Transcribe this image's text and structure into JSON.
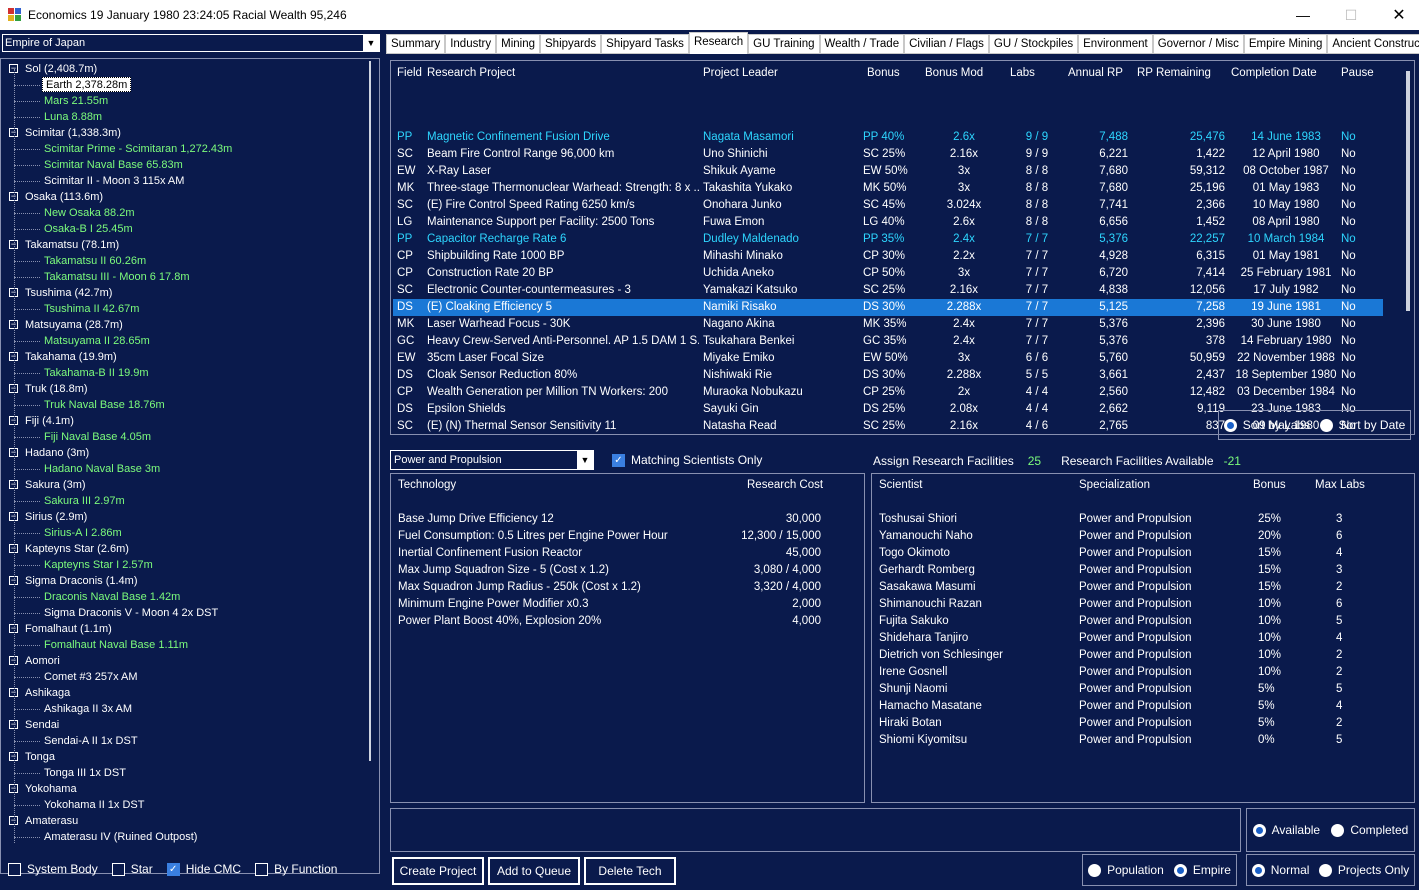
{
  "window": {
    "title": "Economics   19 January 1980 23:24:05   Racial Wealth 95,246",
    "minimize": "—",
    "maximize": "☐",
    "close": "✕"
  },
  "empire_select": {
    "value": "Empire of Japan"
  },
  "tree": [
    {
      "label": "Sol  (2,408.7m)",
      "level": 0,
      "color": "white"
    },
    {
      "label": "Earth  2,378.28m",
      "level": 1,
      "color": "selected"
    },
    {
      "label": "Mars  21.55m",
      "level": 1,
      "color": "green"
    },
    {
      "label": "Luna  8.88m",
      "level": 1,
      "color": "green"
    },
    {
      "label": "Scimitar  (1,338.3m)",
      "level": 0,
      "color": "white"
    },
    {
      "label": "Scimitar Prime - Scimitaran  1,272.43m",
      "level": 1,
      "color": "green"
    },
    {
      "label": "Scimitar Naval Base  65.83m",
      "level": 1,
      "color": "green"
    },
    {
      "label": "Scimitar II - Moon 3  115x AM",
      "level": 1,
      "color": "white"
    },
    {
      "label": "Osaka  (113.6m)",
      "level": 0,
      "color": "white"
    },
    {
      "label": "New Osaka  88.2m",
      "level": 1,
      "color": "green"
    },
    {
      "label": "Osaka-B I  25.45m",
      "level": 1,
      "color": "green"
    },
    {
      "label": "Takamatsu  (78.1m)",
      "level": 0,
      "color": "white"
    },
    {
      "label": "Takamatsu II  60.26m",
      "level": 1,
      "color": "green"
    },
    {
      "label": "Takamatsu III - Moon 6  17.8m",
      "level": 1,
      "color": "green"
    },
    {
      "label": "Tsushima  (42.7m)",
      "level": 0,
      "color": "white"
    },
    {
      "label": "Tsushima II  42.67m",
      "level": 1,
      "color": "green"
    },
    {
      "label": "Matsuyama  (28.7m)",
      "level": 0,
      "color": "white"
    },
    {
      "label": "Matsuyama II  28.65m",
      "level": 1,
      "color": "green"
    },
    {
      "label": "Takahama  (19.9m)",
      "level": 0,
      "color": "white"
    },
    {
      "label": "Takahama-B II  19.9m",
      "level": 1,
      "color": "green"
    },
    {
      "label": "Truk  (18.8m)",
      "level": 0,
      "color": "white"
    },
    {
      "label": "Truk Naval Base  18.76m",
      "level": 1,
      "color": "green"
    },
    {
      "label": "Fiji  (4.1m)",
      "level": 0,
      "color": "white"
    },
    {
      "label": "Fiji Naval Base  4.05m",
      "level": 1,
      "color": "green"
    },
    {
      "label": "Hadano  (3m)",
      "level": 0,
      "color": "white"
    },
    {
      "label": "Hadano Naval Base  3m",
      "level": 1,
      "color": "green"
    },
    {
      "label": "Sakura  (3m)",
      "level": 0,
      "color": "white"
    },
    {
      "label": "Sakura III  2.97m",
      "level": 1,
      "color": "green"
    },
    {
      "label": "Sirius  (2.9m)",
      "level": 0,
      "color": "white"
    },
    {
      "label": "Sirius-A I  2.86m",
      "level": 1,
      "color": "green"
    },
    {
      "label": "Kapteyns Star  (2.6m)",
      "level": 0,
      "color": "white"
    },
    {
      "label": "Kapteyns Star I  2.57m",
      "level": 1,
      "color": "green"
    },
    {
      "label": "Sigma Draconis  (1.4m)",
      "level": 0,
      "color": "white"
    },
    {
      "label": "Draconis Naval Base  1.42m",
      "level": 1,
      "color": "green"
    },
    {
      "label": "Sigma Draconis V - Moon 4  2x DST",
      "level": 1,
      "color": "white"
    },
    {
      "label": "Fomalhaut  (1.1m)",
      "level": 0,
      "color": "white"
    },
    {
      "label": "Fomalhaut Naval Base  1.11m",
      "level": 1,
      "color": "green"
    },
    {
      "label": "Aomori",
      "level": 0,
      "color": "white"
    },
    {
      "label": "Comet #3  257x AM",
      "level": 1,
      "color": "white"
    },
    {
      "label": "Ashikaga",
      "level": 0,
      "color": "white"
    },
    {
      "label": "Ashikaga II  3x AM",
      "level": 1,
      "color": "white"
    },
    {
      "label": "Sendai",
      "level": 0,
      "color": "white"
    },
    {
      "label": "Sendai-A II  1x DST",
      "level": 1,
      "color": "white"
    },
    {
      "label": "Tonga",
      "level": 0,
      "color": "white"
    },
    {
      "label": "Tonga III  1x DST",
      "level": 1,
      "color": "white"
    },
    {
      "label": "Yokohama",
      "level": 0,
      "color": "white"
    },
    {
      "label": "Yokohama II  1x DST",
      "level": 1,
      "color": "white"
    },
    {
      "label": "Amaterasu",
      "level": 0,
      "color": "white"
    },
    {
      "label": "Amaterasu IV  (Ruined Outpost)",
      "level": 1,
      "color": "white"
    }
  ],
  "left_checks": [
    {
      "label": "System Body",
      "checked": false
    },
    {
      "label": "Star",
      "checked": false
    },
    {
      "label": "Hide CMC",
      "checked": true
    },
    {
      "label": "By Function",
      "checked": false
    }
  ],
  "tabs": [
    "Summary",
    "Industry",
    "Mining",
    "Shipyards",
    "Shipyard Tasks",
    "Research",
    "GU Training",
    "Wealth / Trade",
    "Civilian / Flags",
    "GU / Stockpiles",
    "Environment",
    "Governor / Misc",
    "Empire Mining",
    "Ancient Constructs"
  ],
  "active_tab": "Research",
  "project_headers": [
    "Field",
    "Research Project",
    "Project Leader",
    "Bonus",
    "Bonus Mod",
    "Labs",
    "Annual RP",
    "RP Remaining",
    "Completion Date",
    "Pause"
  ],
  "projects": [
    {
      "field": "PP",
      "project": "Magnetic Confinement Fusion Drive",
      "leader": "Nagata Masamori",
      "bonus": "PP 40%",
      "mod": "2.6x",
      "labs": "9 / 9",
      "annual": "7,488",
      "remaining": "25,476",
      "date": "14 June 1983",
      "pause": "No",
      "style": "cyan"
    },
    {
      "field": "SC",
      "project": "Beam Fire Control Range 96,000 km",
      "leader": "Uno Shinichi",
      "bonus": "SC 25%",
      "mod": "2.16x",
      "labs": "9 / 9",
      "annual": "6,221",
      "remaining": "1,422",
      "date": "12 April 1980",
      "pause": "No",
      "style": "white"
    },
    {
      "field": "EW",
      "project": "X-Ray Laser",
      "leader": "Shikuk Ayame",
      "bonus": "EW 50%",
      "mod": "3x",
      "labs": "8 / 8",
      "annual": "7,680",
      "remaining": "59,312",
      "date": "08 October 1987",
      "pause": "No",
      "style": "white"
    },
    {
      "field": "MK",
      "project": "Three-stage Thermonuclear Warhead: Strength: 8 x ...",
      "leader": "Takashita Yukako",
      "bonus": "MK 50%",
      "mod": "3x",
      "labs": "8 / 8",
      "annual": "7,680",
      "remaining": "25,196",
      "date": "01 May 1983",
      "pause": "No",
      "style": "white"
    },
    {
      "field": "SC",
      "project": "(E) Fire Control Speed Rating 6250 km/s",
      "leader": "Onohara Junko",
      "bonus": "SC 45%",
      "mod": "3.024x",
      "labs": "8 / 8",
      "annual": "7,741",
      "remaining": "2,366",
      "date": "10 May 1980",
      "pause": "No",
      "style": "white"
    },
    {
      "field": "LG",
      "project": "Maintenance Support per Facility: 2500 Tons",
      "leader": "Fuwa Emon",
      "bonus": "LG 40%",
      "mod": "2.6x",
      "labs": "8 / 8",
      "annual": "6,656",
      "remaining": "1,452",
      "date": "08 April 1980",
      "pause": "No",
      "style": "white"
    },
    {
      "field": "PP",
      "project": "Capacitor Recharge Rate 6",
      "leader": "Dudley Maldenado",
      "bonus": "PP 35%",
      "mod": "2.4x",
      "labs": "7 / 7",
      "annual": "5,376",
      "remaining": "22,257",
      "date": "10 March 1984",
      "pause": "No",
      "style": "cyan"
    },
    {
      "field": "CP",
      "project": "Shipbuilding Rate 1000 BP",
      "leader": "Mihashi Minako",
      "bonus": "CP 30%",
      "mod": "2.2x",
      "labs": "7 / 7",
      "annual": "4,928",
      "remaining": "6,315",
      "date": "01 May 1981",
      "pause": "No",
      "style": "white"
    },
    {
      "field": "CP",
      "project": "Construction Rate 20 BP",
      "leader": "Uchida Aneko",
      "bonus": "CP 50%",
      "mod": "3x",
      "labs": "7 / 7",
      "annual": "6,720",
      "remaining": "7,414",
      "date": "25 February 1981",
      "pause": "No",
      "style": "white"
    },
    {
      "field": "SC",
      "project": "Electronic Counter-countermeasures - 3",
      "leader": "Yamakazi Katsuko",
      "bonus": "SC 25%",
      "mod": "2.16x",
      "labs": "7 / 7",
      "annual": "4,838",
      "remaining": "12,056",
      "date": "17 July 1982",
      "pause": "No",
      "style": "white"
    },
    {
      "field": "DS",
      "project": "(E) Cloaking Efficiency 5",
      "leader": "Namiki Risako",
      "bonus": "DS 30%",
      "mod": "2.288x",
      "labs": "7 / 7",
      "annual": "5,125",
      "remaining": "7,258",
      "date": "19 June 1981",
      "pause": "No",
      "style": "sel"
    },
    {
      "field": "MK",
      "project": "Laser Warhead Focus - 30K",
      "leader": "Nagano Akina",
      "bonus": "MK 35%",
      "mod": "2.4x",
      "labs": "7 / 7",
      "annual": "5,376",
      "remaining": "2,396",
      "date": "30 June 1980",
      "pause": "No",
      "style": "white"
    },
    {
      "field": "GC",
      "project": "Heavy Crew-Served Anti-Personnel. AP 1.5 DAM 1 S...",
      "leader": "Tsukahara Benkei",
      "bonus": "GC 35%",
      "mod": "2.4x",
      "labs": "7 / 7",
      "annual": "5,376",
      "remaining": "378",
      "date": "14 February 1980",
      "pause": "No",
      "style": "white"
    },
    {
      "field": "EW",
      "project": "35cm Laser Focal Size",
      "leader": "Miyake Emiko",
      "bonus": "EW 50%",
      "mod": "3x",
      "labs": "6 / 6",
      "annual": "5,760",
      "remaining": "50,959",
      "date": "22 November 1988",
      "pause": "No",
      "style": "white"
    },
    {
      "field": "DS",
      "project": "Cloak Sensor Reduction 80%",
      "leader": "Nishiwaki Rie",
      "bonus": "DS 30%",
      "mod": "2.288x",
      "labs": "5 / 5",
      "annual": "3,661",
      "remaining": "2,437",
      "date": "18 September 1980",
      "pause": "No",
      "style": "white"
    },
    {
      "field": "CP",
      "project": "Wealth Generation per Million TN Workers: 200",
      "leader": "Muraoka Nobukazu",
      "bonus": "CP 25%",
      "mod": "2x",
      "labs": "4 / 4",
      "annual": "2,560",
      "remaining": "12,482",
      "date": "03 December 1984",
      "pause": "No",
      "style": "white"
    },
    {
      "field": "DS",
      "project": "Epsilon Shields",
      "leader": "Sayuki Gin",
      "bonus": "DS 25%",
      "mod": "2.08x",
      "labs": "4 / 4",
      "annual": "2,662",
      "remaining": "9,119",
      "date": "23 June 1983",
      "pause": "No",
      "style": "white"
    },
    {
      "field": "SC",
      "project": "(E) (N) Thermal Sensor Sensitivity 11",
      "leader": "Natasha Read",
      "bonus": "SC 25%",
      "mod": "2.16x",
      "labs": "4 / 6",
      "annual": "2,765",
      "remaining": "837",
      "date": "09 May 1980",
      "pause": "No",
      "style": "white"
    }
  ],
  "sort": {
    "labs_label": "Sort by Labs",
    "date_label": "Sort by Date",
    "selected": "labs"
  },
  "field_select": {
    "value": "Power and Propulsion"
  },
  "matching_label": "Matching Scientists Only",
  "assign": {
    "label": "Assign Research Facilities",
    "value": "25",
    "avail_label": "Research Facilities Available",
    "avail_value": "-21"
  },
  "tech_headers": [
    "Technology",
    "Research Cost"
  ],
  "techs": [
    {
      "name": "Base Jump Drive Efficiency 12",
      "cost": "30,000"
    },
    {
      "name": "Fuel Consumption: 0.5 Litres per Engine Power Hour",
      "cost": "12,300 / 15,000"
    },
    {
      "name": "Inertial Confinement Fusion Reactor",
      "cost": "45,000"
    },
    {
      "name": "Max Jump Squadron Size - 5 (Cost x 1.2)",
      "cost": "3,080 / 4,000"
    },
    {
      "name": "Max Squadron Jump Radius - 250k (Cost x 1.2)",
      "cost": "3,320 / 4,000"
    },
    {
      "name": "Minimum Engine Power Modifier x0.3",
      "cost": "2,000"
    },
    {
      "name": "Power Plant Boost 40%, Explosion 20%",
      "cost": "4,000"
    }
  ],
  "sci_headers": [
    "Scientist",
    "Specialization",
    "Bonus",
    "Max Labs"
  ],
  "scientists": [
    {
      "name": "Toshusai Shiori",
      "spec": "Power and Propulsion",
      "bonus": "25%",
      "labs": "3"
    },
    {
      "name": "Yamanouchi Naho",
      "spec": "Power and Propulsion",
      "bonus": "20%",
      "labs": "6"
    },
    {
      "name": "Togo Okimoto",
      "spec": "Power and Propulsion",
      "bonus": "15%",
      "labs": "4"
    },
    {
      "name": "Gerhardt Romberg",
      "spec": "Power and Propulsion",
      "bonus": "15%",
      "labs": "3"
    },
    {
      "name": "Sasakawa Masumi",
      "spec": "Power and Propulsion",
      "bonus": "15%",
      "labs": "2"
    },
    {
      "name": "Shimanouchi Razan",
      "spec": "Power and Propulsion",
      "bonus": "10%",
      "labs": "6"
    },
    {
      "name": "Fujita Sakuko",
      "spec": "Power and Propulsion",
      "bonus": "10%",
      "labs": "5"
    },
    {
      "name": "Shidehara Tanjiro",
      "spec": "Power and Propulsion",
      "bonus": "10%",
      "labs": "4"
    },
    {
      "name": "Dietrich von Schlesinger",
      "spec": "Power and Propulsion",
      "bonus": "10%",
      "labs": "2"
    },
    {
      "name": "Irene Gosnell",
      "spec": "Power and Propulsion",
      "bonus": "10%",
      "labs": "2"
    },
    {
      "name": "Shunji Naomi",
      "spec": "Power and Propulsion",
      "bonus": "5%",
      "labs": "5"
    },
    {
      "name": "Hamacho Masatane",
      "spec": "Power and Propulsion",
      "bonus": "5%",
      "labs": "4"
    },
    {
      "name": "Hiraki Botan",
      "spec": "Power and Propulsion",
      "bonus": "5%",
      "labs": "2"
    },
    {
      "name": "Shiomi Kiyomitsu",
      "spec": "Power and Propulsion",
      "bonus": "0%",
      "labs": "5"
    }
  ],
  "available": {
    "avail_label": "Available",
    "completed_label": "Completed",
    "selected": "available"
  },
  "buttons": {
    "create": "Create Project",
    "queue": "Add to Queue",
    "delete": "Delete Tech"
  },
  "pop": {
    "pop_label": "Population",
    "empire_label": "Empire",
    "selected": "empire"
  },
  "mode": {
    "normal_label": "Normal",
    "projects_label": "Projects Only",
    "selected": "normal"
  },
  "colors": {
    "background": "#0a1a4c",
    "green": "#7cfc7c",
    "cyan": "#2ed6ff",
    "selected_row": "#1a78d6"
  }
}
